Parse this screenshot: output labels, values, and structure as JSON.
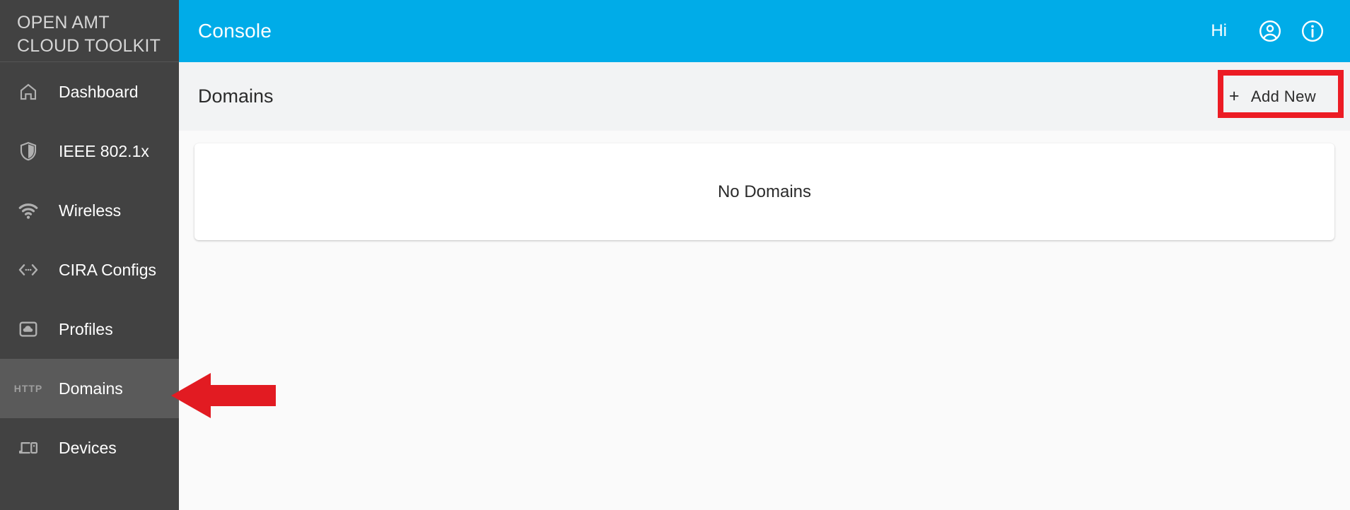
{
  "sidebar": {
    "brand": {
      "line1": "OPEN AMT",
      "line2": "CLOUD TOOLKIT"
    },
    "items": [
      {
        "label": "Dashboard",
        "icon": "home-icon",
        "active": false
      },
      {
        "label": "IEEE 802.1x",
        "icon": "shield-icon",
        "active": false
      },
      {
        "label": "Wireless",
        "icon": "wifi-icon",
        "active": false
      },
      {
        "label": "CIRA Configs",
        "icon": "code-icon",
        "active": false
      },
      {
        "label": "Profiles",
        "icon": "cloud-box-icon",
        "active": false
      },
      {
        "label": "Domains",
        "icon": "http-icon",
        "active": true
      },
      {
        "label": "Devices",
        "icon": "devices-icon",
        "active": false
      }
    ]
  },
  "topbar": {
    "app_title": "Console",
    "greeting": "Hi",
    "account_icon": "account-circle-icon",
    "info_icon": "info-circle-icon",
    "background_color": "#00ace8"
  },
  "page_header": {
    "title": "Domains",
    "add_new_label": "Add New",
    "add_new_plus": "+"
  },
  "content": {
    "empty_message": "No Domains"
  },
  "annotations": {
    "highlight_color": "#ec1c24",
    "highlight_target": "Add New",
    "arrow_color": "#e21b22",
    "arrow_target": "Domains"
  }
}
